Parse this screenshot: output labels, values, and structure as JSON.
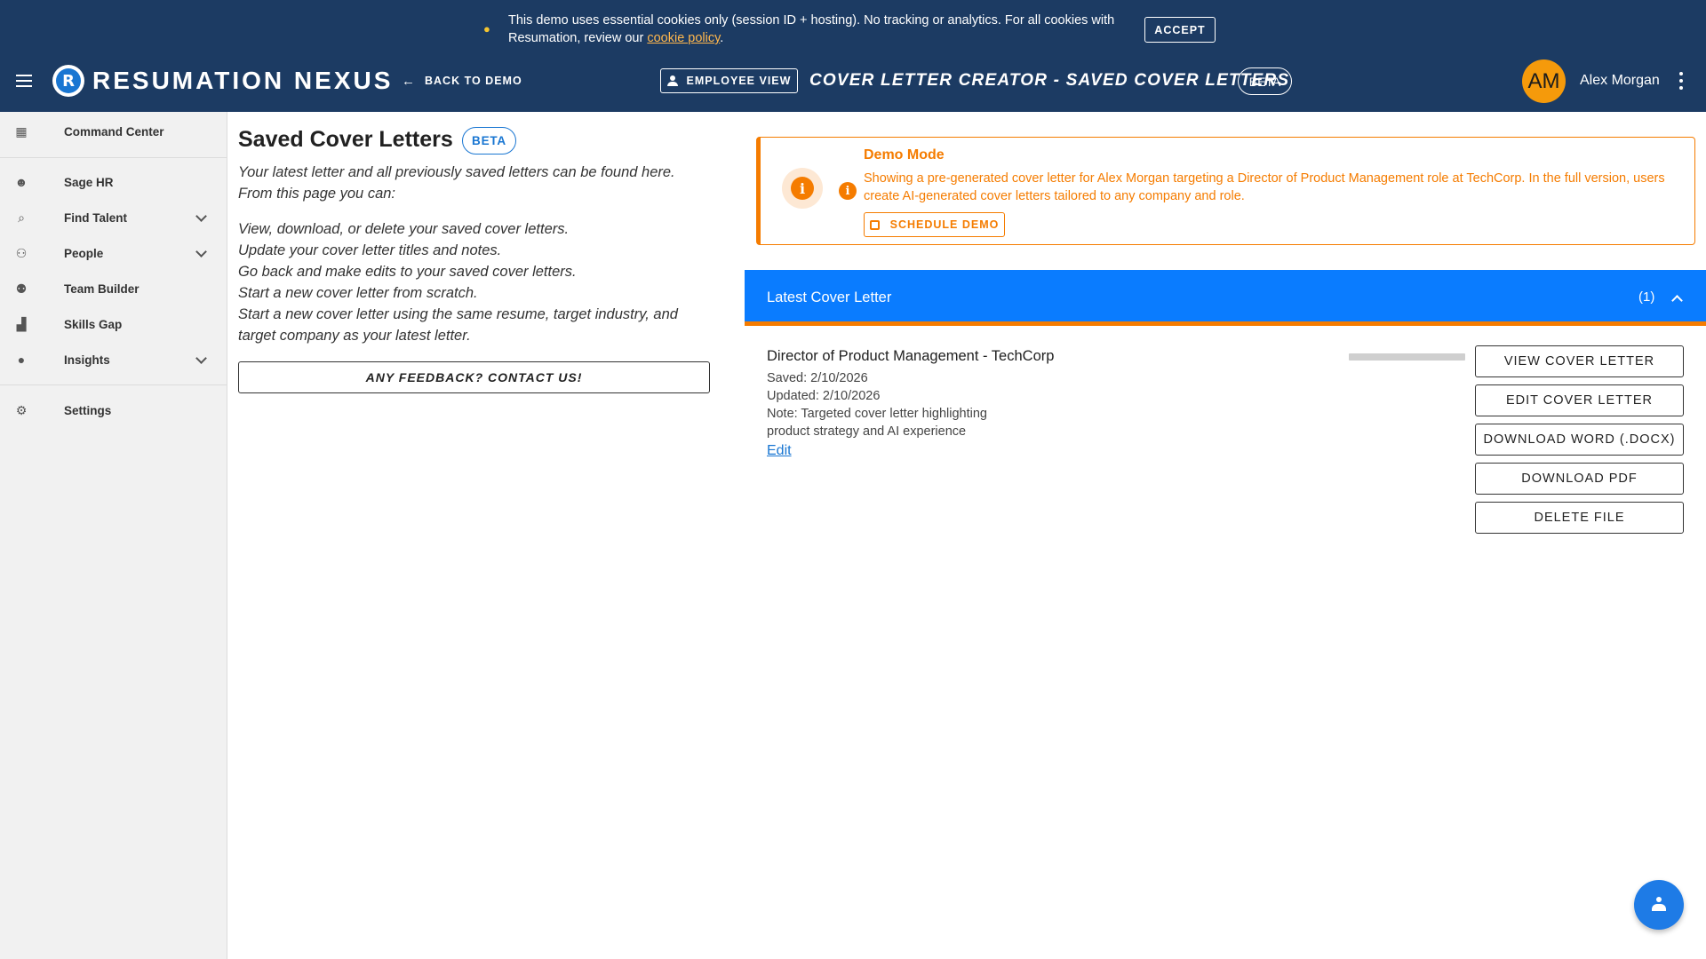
{
  "cookie_banner": {
    "text_before": "This demo uses essential cookies only (session ID + hosting). No tracking or analytics. For all cookies with Resumation, review our ",
    "link": "cookie policy",
    "text_after": ".",
    "accept": "ACCEPT"
  },
  "header": {
    "brand": "RESUMATION NEXUS",
    "logo_letter": "R",
    "back": "BACK TO DEMO",
    "employee_view": "EMPLOYEE VIEW",
    "page_title": "COVER LETTER CREATOR - SAVED COVER LETTERS",
    "beta": "BETA",
    "avatar_initials": "AM",
    "user_name": "Alex Morgan"
  },
  "sidebar": {
    "items": [
      {
        "label": "Command Center",
        "icon": "dashboard-icon"
      },
      {
        "label": "Sage HR",
        "icon": "robot-icon"
      },
      {
        "label": "Find Talent",
        "icon": "search-icon",
        "expandable": true
      },
      {
        "label": "People",
        "icon": "people-icon",
        "expandable": true
      },
      {
        "label": "Team Builder",
        "icon": "group-add-icon"
      },
      {
        "label": "Skills Gap",
        "icon": "chart-icon"
      },
      {
        "label": "Insights",
        "icon": "lightbulb-icon",
        "expandable": true
      },
      {
        "label": "Settings",
        "icon": "gear-icon"
      }
    ]
  },
  "main": {
    "title": "Saved Cover Letters",
    "beta": "BETA",
    "intro_line1": "Your latest letter and all previously saved letters can be found here.",
    "intro_line2": "From this page you can:",
    "bullets": [
      "View, download, or delete your saved cover letters.",
      "Update your cover letter titles and notes.",
      "Go back and make edits to your saved cover letters.",
      "Start a new cover letter from scratch.",
      "Start a new cover letter using the same resume, target industry, and target company as your latest letter."
    ],
    "feedback": "ANY FEEDBACK? CONTACT US!"
  },
  "demo_alert": {
    "title": "Demo Mode",
    "text": "Showing a pre-generated cover letter for Alex Morgan targeting a Director of Product Management role at TechCorp. In the full version, users create AI-generated cover letters tailored to any company and role.",
    "button": "SCHEDULE DEMO",
    "color": "#f57c00"
  },
  "latest": {
    "label": "Latest Cover Letter",
    "count": "(1)",
    "bar_color": "#0a7cff",
    "letter": {
      "title": "Director of Product Management - TechCorp",
      "saved": "Saved: 2/10/2026",
      "updated": "Updated: 2/10/2026",
      "note": "Note: Targeted cover letter highlighting product strategy and AI experience",
      "edit": "Edit"
    },
    "actions": [
      "VIEW COVER LETTER",
      "EDIT COVER LETTER",
      "DOWNLOAD WORD (.DOCX)",
      "DOWNLOAD PDF",
      "DELETE FILE"
    ]
  },
  "colors": {
    "header_bg": "#1c3b63",
    "accent": "#1976d2",
    "avatar": "#f59a0b"
  }
}
